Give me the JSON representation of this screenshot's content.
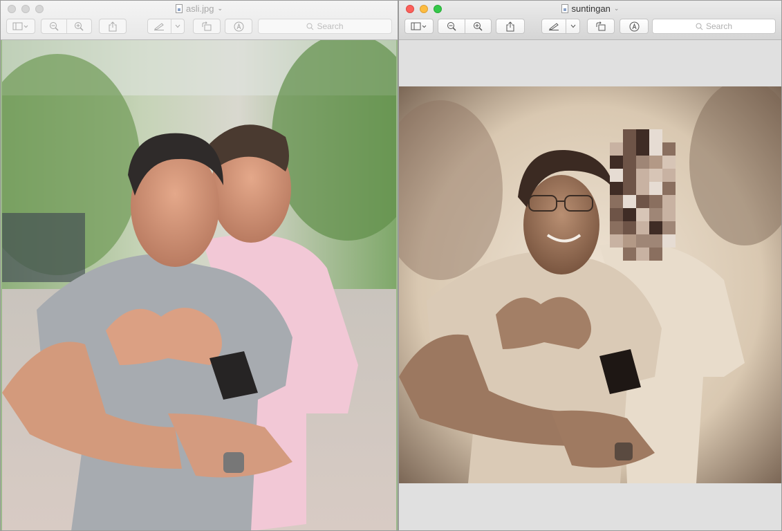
{
  "windows": [
    {
      "id": "left",
      "title": "asli.jpg",
      "active": false,
      "toolbar": {
        "search_placeholder": "Search"
      },
      "image_alt": "Two men in t-shirts posing outdoors, one forming a heart shape with his hands"
    },
    {
      "id": "right",
      "title": "suntingan",
      "active": true,
      "toolbar": {
        "search_placeholder": "Search"
      },
      "image_alt": "Sepia edited version of the photo with a different face and the second face pixelated"
    }
  ],
  "icons": {
    "sidebar": "sidebar-icon",
    "zoom_out": "zoom-out-icon",
    "zoom_in": "zoom-in-icon",
    "share": "share-icon",
    "markup": "pen-icon",
    "rotate": "rotate-icon",
    "annotate": "markup-icon",
    "search": "search-icon"
  },
  "colors": {
    "close": "#fc605b",
    "minimize": "#fdbc40",
    "maximize": "#34c84a",
    "sepia": "#c9b49a"
  }
}
